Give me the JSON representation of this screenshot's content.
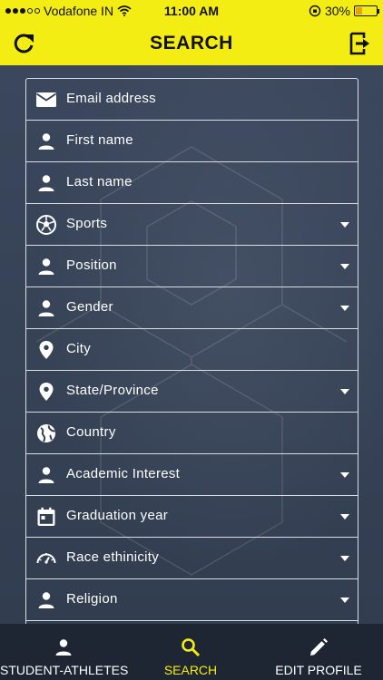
{
  "status_bar": {
    "carrier": "Vodafone IN",
    "time": "11:00 AM",
    "battery": "30%",
    "battery_level": 0.3
  },
  "header": {
    "title": "SEARCH",
    "left_icon": "refresh-icon",
    "right_icon": "logout-icon"
  },
  "form": {
    "fields": [
      {
        "placeholder": "Email address",
        "icon": "email-icon",
        "dropdown": false
      },
      {
        "placeholder": "First name",
        "icon": "person-icon",
        "dropdown": false
      },
      {
        "placeholder": "Last name",
        "icon": "person-icon",
        "dropdown": false
      },
      {
        "placeholder": "Sports",
        "icon": "soccer-ball-icon",
        "dropdown": true
      },
      {
        "placeholder": "Position",
        "icon": "person-icon",
        "dropdown": true
      },
      {
        "placeholder": "Gender",
        "icon": "person-icon",
        "dropdown": true
      },
      {
        "placeholder": "City",
        "icon": "location-pin-icon",
        "dropdown": false
      },
      {
        "placeholder": "State/Province",
        "icon": "location-pin-icon",
        "dropdown": true
      },
      {
        "placeholder": "Country",
        "icon": "globe-icon",
        "dropdown": false
      },
      {
        "placeholder": "Academic Interest",
        "icon": "person-icon",
        "dropdown": true
      },
      {
        "placeholder": "Graduation year",
        "icon": "calendar-icon",
        "dropdown": true
      },
      {
        "placeholder": "Race ethinicity",
        "icon": "speedometer-icon",
        "dropdown": true
      },
      {
        "placeholder": "Religion",
        "icon": "person-icon",
        "dropdown": true
      }
    ]
  },
  "tabbar": {
    "tabs": [
      {
        "label": "STUDENT-ATHLETES",
        "icon": "person-icon",
        "active": false
      },
      {
        "label": "SEARCH",
        "icon": "search-icon",
        "active": true
      },
      {
        "label": "EDIT PROFILE",
        "icon": "pencil-icon",
        "active": false
      }
    ]
  },
  "colors": {
    "accent": "#f4ed14",
    "background": "#333f52",
    "tabbar": "#1e2634"
  }
}
